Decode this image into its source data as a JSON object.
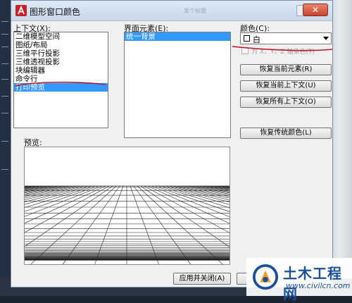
{
  "dialog": {
    "title": "图形窗口颜色",
    "title_right_text": "某个标题"
  },
  "context": {
    "label": "上下文(X):",
    "items": [
      "二维模型空间",
      "图纸/布局",
      "三维平行投影",
      "三维透视投影",
      "块编辑器",
      "命令行",
      "打印预览"
    ],
    "selected_index": 6
  },
  "elements": {
    "label": "界面元素(E):",
    "items": [
      "统一背景"
    ],
    "selected_index": 0
  },
  "color": {
    "label": "颜色(C):",
    "selected_value": "白",
    "swatch_color": "#ffffff"
  },
  "tint_checkbox": {
    "label": "为 X、Y、Z 轴染色(T)",
    "checked": false,
    "enabled": false
  },
  "buttons": {
    "restore_element": "恢复当前元素(R)",
    "restore_context": "恢复当前上下文(U)",
    "restore_all_contexts": "恢复所有上下文(O)",
    "restore_classic": "恢复传统颜色(L)",
    "apply_close": "应用并关闭(A)"
  },
  "preview": {
    "label": "预览:"
  },
  "watermark": {
    "title": "土木工程网",
    "url": "www.civilcn.com"
  },
  "colors": {
    "annotation_red": "#c0102a",
    "selection_blue": "#3399ff",
    "dialog_bg": "#f0f0f0",
    "brand_blue": "#1a4f9c"
  }
}
